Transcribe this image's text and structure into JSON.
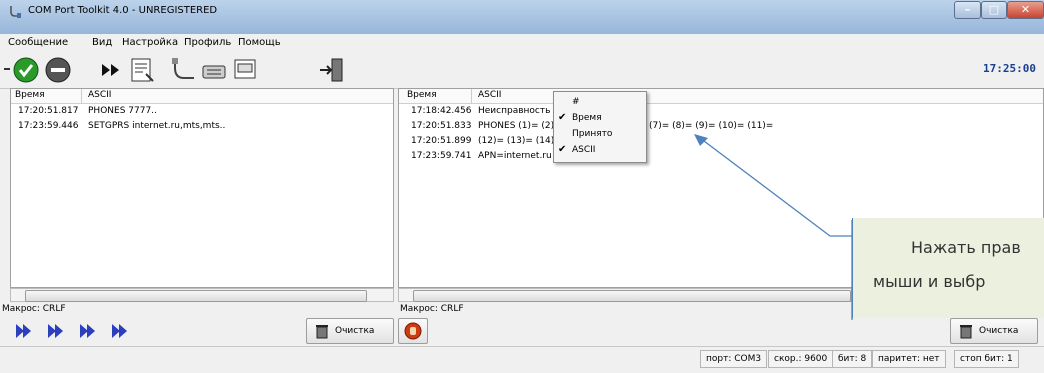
{
  "window": {
    "title": "COM Port Toolkit 4.0 - UNREGISTERED",
    "minimize": "–",
    "maximize": "□",
    "close": "✕"
  },
  "menu": [
    "Сообщение",
    "Вид",
    "Настройка",
    "Профиль",
    "Помощь"
  ],
  "toolbar": {
    "clock": "17:25:00"
  },
  "left_panel": {
    "columns": [
      "Время",
      "ASCII"
    ],
    "rows": [
      {
        "time": "17:20:51.817",
        "text": "PHONES 7777.."
      },
      {
        "time": "17:23:59.446",
        "text": "SETGPRS internet.ru,mts,mts.."
      }
    ],
    "macro": "Макрос: CRLF",
    "clear_label": "Очистка"
  },
  "right_panel": {
    "columns": [
      "Время",
      "ASCII"
    ],
    "rows": [
      {
        "time": "17:18:42.456",
        "text": "Неисправность з"
      },
      {
        "time": "17:20:51.833",
        "text": "PHONES (1)= (2)"
      },
      {
        "time": "17:20:51.899",
        "text": "(12)= (13)= (14)"
      },
      {
        "time": "17:23:59.741",
        "text": "APN=internet.ru"
      }
    ],
    "row2_tail": "(7)= (8)= (9)= (10)= (11)=",
    "macro": "Макрос: CRLF",
    "clear_label": "Очистка"
  },
  "context_menu": {
    "items": [
      {
        "label": "#",
        "checked": false
      },
      {
        "label": "Время",
        "checked": true
      },
      {
        "label": "Принято",
        "checked": false
      },
      {
        "label": "ASCII",
        "checked": true
      }
    ],
    "check_glyph": "✔"
  },
  "status": [
    "порт: COM3",
    "скор.: 9600",
    "бит: 8",
    "паритет: нет",
    "стоп бит: 1"
  ],
  "callout": {
    "line1": "Нажать прав",
    "line2": "мыши и выбр"
  },
  "colors": {
    "accent": "#4f81bd",
    "callout_bg": "#ebf1de",
    "clock": "#1a3f8f"
  }
}
